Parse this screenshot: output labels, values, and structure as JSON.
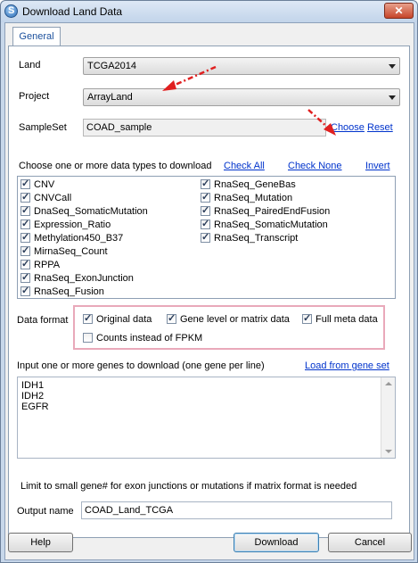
{
  "window": {
    "title": "Download Land Data",
    "close_label": "✕"
  },
  "tabs": [
    {
      "label": "General"
    }
  ],
  "land": {
    "label": "Land",
    "value": "TCGA2014"
  },
  "project": {
    "label": "Project",
    "value": "ArrayLand"
  },
  "sampleset": {
    "label": "SampleSet",
    "value": "COAD_sample",
    "choose_label": "Choose",
    "reset_label": "Reset"
  },
  "datatypes": {
    "prompt": "Choose one or more data types to download",
    "check_all": "Check All",
    "check_none": "Check None",
    "invert": "Invert",
    "items": [
      {
        "label": "CNV",
        "checked": true
      },
      {
        "label": "CNVCall",
        "checked": true
      },
      {
        "label": "DnaSeq_SomaticMutation",
        "checked": true
      },
      {
        "label": "Expression_Ratio",
        "checked": true
      },
      {
        "label": "Methylation450_B37",
        "checked": true
      },
      {
        "label": "MirnaSeq_Count",
        "checked": true
      },
      {
        "label": "RPPA",
        "checked": true
      },
      {
        "label": "RnaSeq_ExonJunction",
        "checked": true
      },
      {
        "label": "RnaSeq_Fusion",
        "checked": true
      },
      {
        "label": "RnaSeq_GeneBas",
        "checked": true
      },
      {
        "label": "RnaSeq_Mutation",
        "checked": true
      },
      {
        "label": "RnaSeq_PairedEndFusion",
        "checked": true
      },
      {
        "label": "RnaSeq_SomaticMutation",
        "checked": true
      },
      {
        "label": "RnaSeq_Transcript",
        "checked": true
      }
    ]
  },
  "data_format": {
    "label": "Data format",
    "original": {
      "label": "Original data",
      "checked": true
    },
    "gene_level": {
      "label": "Gene level or matrix data",
      "checked": true
    },
    "full_meta": {
      "label": "Full meta data",
      "checked": true
    },
    "counts": {
      "label": "Counts instead of FPKM",
      "checked": false
    }
  },
  "genes": {
    "prompt": "Input one or more genes to download (one gene per line)",
    "load_link": "Load from gene set",
    "lines": [
      "IDH1",
      "IDH2",
      "EGFR"
    ]
  },
  "note": "Limit to small gene# for exon junctions or mutations if matrix format is needed",
  "output": {
    "label": "Output name",
    "value": "COAD_Land_TCGA"
  },
  "buttons": {
    "help": "Help",
    "download": "Download",
    "cancel": "Cancel"
  },
  "colors": {
    "annotation_arrow": "#e02020",
    "highlight_frame": "#e9a9ba",
    "link": "#0033cc"
  }
}
